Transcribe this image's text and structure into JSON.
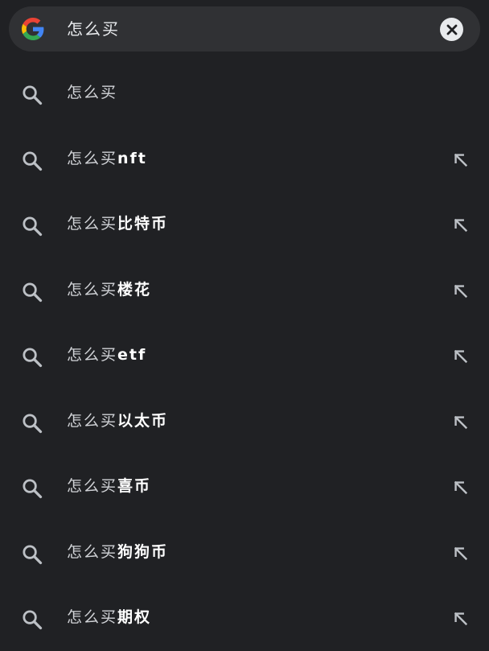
{
  "search_bar": {
    "logo_icon": "google-g-logo",
    "query": "怎么买",
    "clear_icon": "close-icon"
  },
  "suggestions": [
    {
      "prefix": "怎么买",
      "suffix": "",
      "has_fill_arrow": false
    },
    {
      "prefix": "怎么买",
      "suffix": "nft",
      "has_fill_arrow": true
    },
    {
      "prefix": "怎么买",
      "suffix": "比特币",
      "has_fill_arrow": true
    },
    {
      "prefix": "怎么买",
      "suffix": "楼花",
      "has_fill_arrow": true
    },
    {
      "prefix": "怎么买",
      "suffix": "etf",
      "has_fill_arrow": true
    },
    {
      "prefix": "怎么买",
      "suffix": "以太币",
      "has_fill_arrow": true
    },
    {
      "prefix": "怎么买",
      "suffix": "喜币",
      "has_fill_arrow": true
    },
    {
      "prefix": "怎么买",
      "suffix": "狗狗币",
      "has_fill_arrow": true
    },
    {
      "prefix": "怎么买",
      "suffix": "期权",
      "has_fill_arrow": true
    }
  ],
  "colors": {
    "background": "#202124",
    "search_bar": "#303134",
    "text": "#e8eaed",
    "icon": "#bdc1c6"
  }
}
